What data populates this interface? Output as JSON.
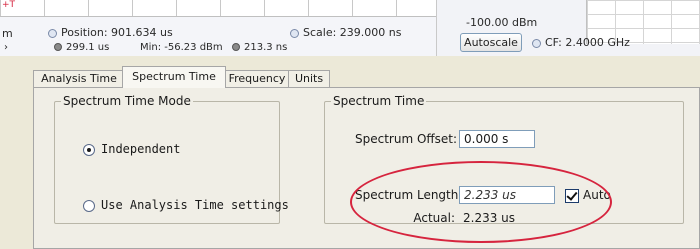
{
  "top": {
    "left_corner_label": "m",
    "left_markers": "› ›",
    "position": "Position: 901.634 us",
    "scale": "Scale: 239.000 ns",
    "marker_time": "299.1 us",
    "min": "Min: -56.23 dBm",
    "marker_delta": "213.3 ns",
    "ref_level": "-100.00 dBm",
    "autoscale_button": "Autoscale",
    "center_freq": "CF: 2.4000 GHz",
    "tick_glyph": "+T"
  },
  "tabs": [
    {
      "label": "Analysis Time",
      "active": false
    },
    {
      "label": "Spectrum Time",
      "active": true
    },
    {
      "label": "Frequency",
      "active": false
    },
    {
      "label": "Units",
      "active": false
    }
  ],
  "spectrum_time_mode": {
    "legend": "Spectrum Time Mode",
    "options": [
      {
        "label": "Independent",
        "checked": true
      },
      {
        "label": "Use Analysis Time settings",
        "checked": false
      }
    ]
  },
  "spectrum_time": {
    "legend": "Spectrum Time",
    "offset_label": "Spectrum Offset:",
    "offset_value": "0.000 s",
    "length_label": "Spectrum Length:",
    "length_value": "2.233 us",
    "auto_label": "Auto",
    "auto_checked": true,
    "actual_label": "Actual:",
    "actual_value": "2.233 us"
  },
  "colors": {
    "annotation": "#d6243e",
    "panel": "#ece9d8"
  }
}
